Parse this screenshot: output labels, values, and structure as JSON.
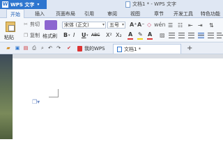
{
  "app": {
    "name": "WPS 文字",
    "logo": "W",
    "window_title": "文档1 * - WPS 文字"
  },
  "tabs": [
    "开始",
    "插入",
    "页面布局",
    "引用",
    "审阅",
    "视图",
    "章节",
    "开发工具",
    "特色功能"
  ],
  "ribbon": {
    "paste_label": "粘贴",
    "cut_label": "剪切",
    "copy_label": "复制",
    "format_painter_label": "格式刷",
    "font_name": "宋体 (正文)",
    "font_size": "五号",
    "bold": "B",
    "italic": "I",
    "underline": "U",
    "strike": "ABC",
    "superscript": "X²",
    "subscript": "X₂",
    "font_color": "A",
    "grow_font": "A⁺",
    "shrink_font": "A⁻",
    "clear_format": "A"
  },
  "quick_access": {
    "icons": [
      "open-icon",
      "save-icon",
      "print-preview-icon",
      "print-icon",
      "undo-icon",
      "redo-icon"
    ]
  },
  "doc_tabs": {
    "wps_label": "我的WPS",
    "doc_label": "文档1 *",
    "add_symbol": "+"
  },
  "colors": {
    "brand": "#2e76cf",
    "ribbon_bg": "#f4f7fb",
    "tabs_bg": "#dfe7f3",
    "workspace": "#d9dde3"
  }
}
